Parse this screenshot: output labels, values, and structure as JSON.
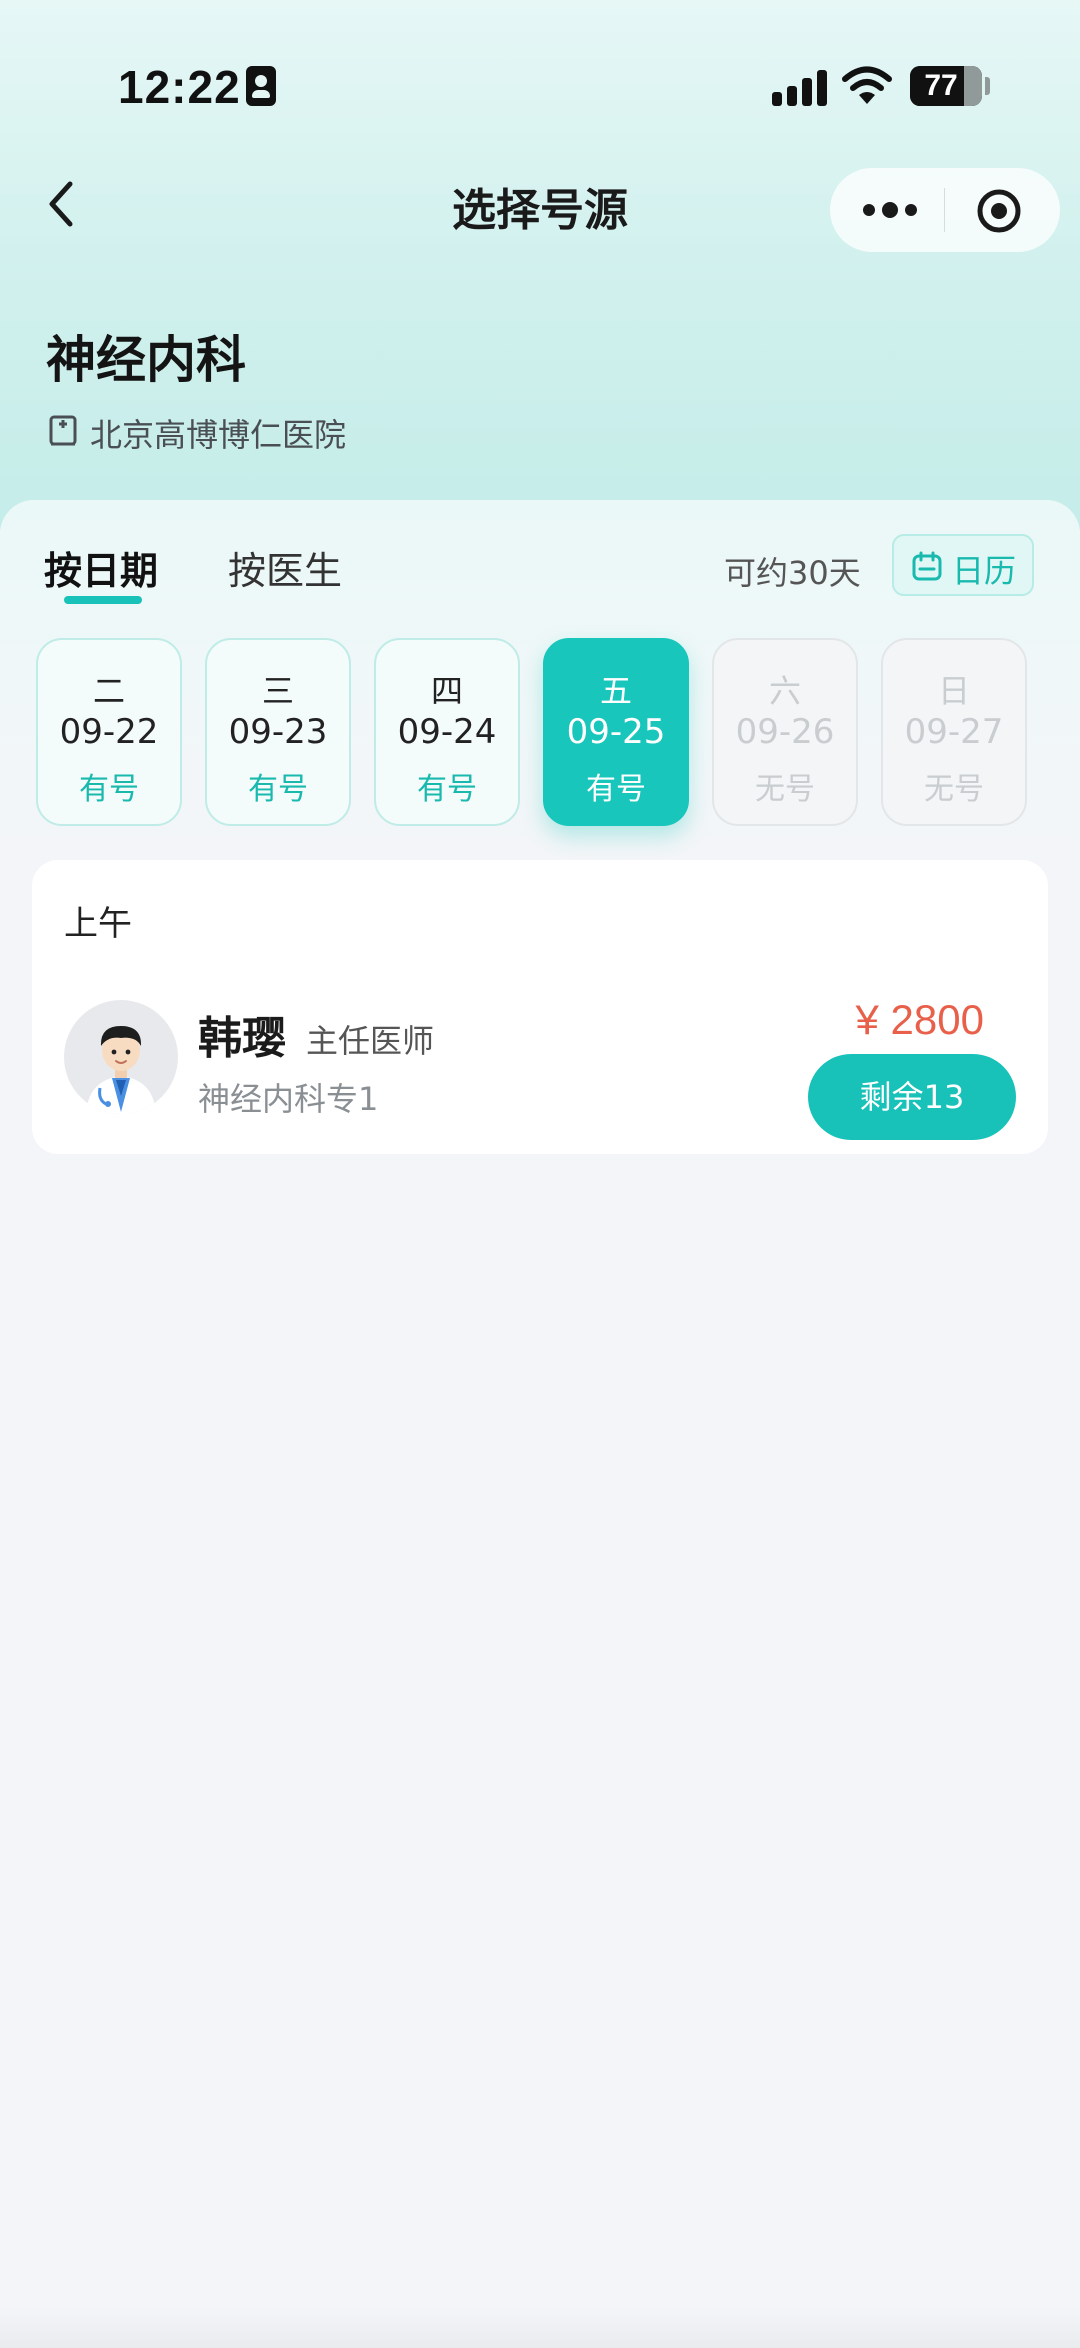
{
  "status_bar": {
    "time": "12:22",
    "battery": "77",
    "icons": [
      "id-card-icon",
      "signal-icon",
      "wifi-icon",
      "battery-icon"
    ]
  },
  "nav": {
    "title": "选择号源",
    "back_icon": "chevron-left-icon",
    "more_icon": "more-dots-icon",
    "close_icon": "target-circle-icon"
  },
  "department": {
    "name": "神经内科",
    "hospital": "北京高博博仁医院",
    "hospital_icon": "hospital-building-icon"
  },
  "tabs": [
    {
      "label": "按日期",
      "active": true
    },
    {
      "label": "按医生",
      "active": false
    }
  ],
  "booking_range": "可约30天",
  "calendar_button": {
    "label": "日历",
    "icon": "calendar-icon"
  },
  "dates": [
    {
      "weekday": "二",
      "date": "09-22",
      "status": "有号",
      "state": "available"
    },
    {
      "weekday": "三",
      "date": "09-23",
      "status": "有号",
      "state": "available"
    },
    {
      "weekday": "四",
      "date": "09-24",
      "status": "有号",
      "state": "available"
    },
    {
      "weekday": "五",
      "date": "09-25",
      "status": "有号",
      "state": "selected"
    },
    {
      "weekday": "六",
      "date": "09-26",
      "status": "无号",
      "state": "unavailable"
    },
    {
      "weekday": "日",
      "date": "09-27",
      "status": "无号",
      "state": "unavailable"
    }
  ],
  "schedule": {
    "period": "上午",
    "doctors": [
      {
        "name": "韩璎",
        "title": "主任医师",
        "clinic": "神经内科专1",
        "price": "¥ 2800",
        "remaining": "剩余13",
        "avatar": "doctor-avatar"
      }
    ]
  },
  "colors": {
    "accent": "#19c2b8",
    "price": "#e8604a",
    "header_bg": "#d2f1ee",
    "page_bg": "#f3f5f8"
  }
}
